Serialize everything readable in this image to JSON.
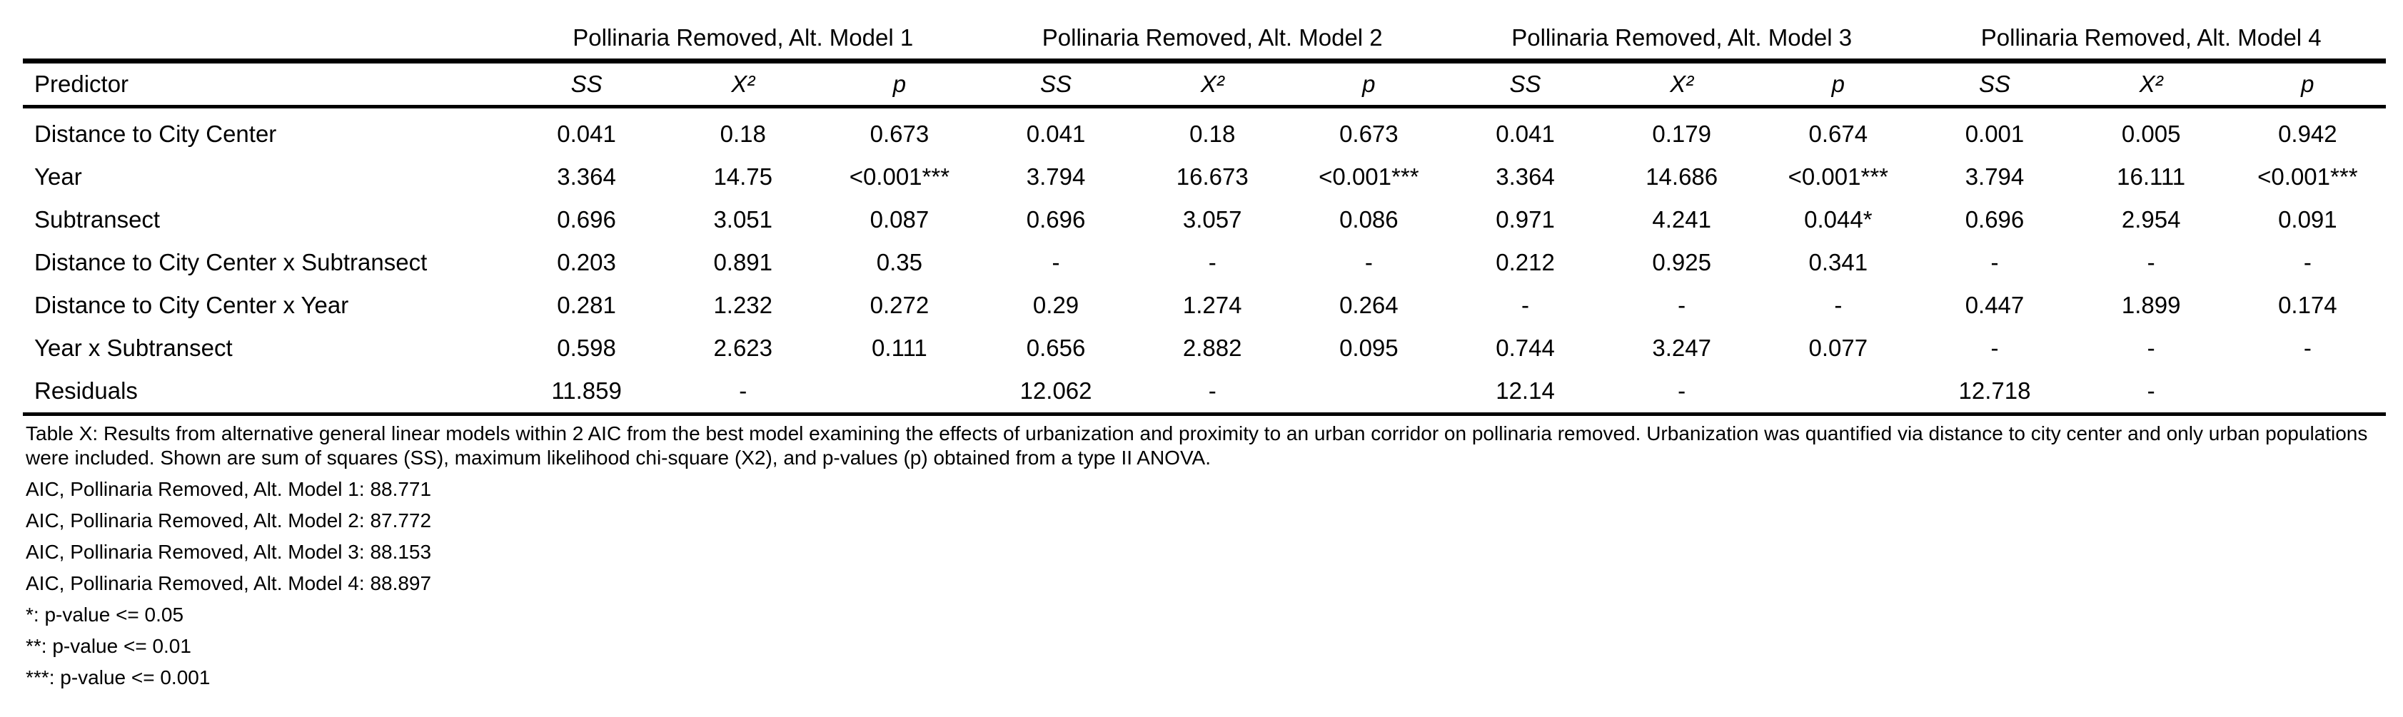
{
  "table": {
    "groups": [
      "Pollinaria Removed, Alt. Model 1",
      "Pollinaria Removed, Alt. Model 2",
      "Pollinaria Removed, Alt. Model 3",
      "Pollinaria Removed, Alt. Model 4"
    ],
    "predictor_header": "Predictor",
    "stat_headers": [
      "SS",
      "X²",
      "p"
    ],
    "rows": [
      {
        "predictor": "Distance to City Center",
        "cells": [
          "0.041",
          "0.18",
          "0.673",
          "0.041",
          "0.18",
          "0.673",
          "0.041",
          "0.179",
          "0.674",
          "0.001",
          "0.005",
          "0.942"
        ]
      },
      {
        "predictor": "Year",
        "cells": [
          "3.364",
          "14.75",
          "<0.001***",
          "3.794",
          "16.673",
          "<0.001***",
          "3.364",
          "14.686",
          "<0.001***",
          "3.794",
          "16.111",
          "<0.001***"
        ]
      },
      {
        "predictor": "Subtransect",
        "cells": [
          "0.696",
          "3.051",
          "0.087",
          "0.696",
          "3.057",
          "0.086",
          "0.971",
          "4.241",
          "0.044*",
          "0.696",
          "2.954",
          "0.091"
        ]
      },
      {
        "predictor": "Distance to City Center x Subtransect",
        "cells": [
          "0.203",
          "0.891",
          "0.35",
          "-",
          "-",
          "-",
          "0.212",
          "0.925",
          "0.341",
          "-",
          "-",
          "-"
        ]
      },
      {
        "predictor": "Distance to City Center x Year",
        "cells": [
          "0.281",
          "1.232",
          "0.272",
          "0.29",
          "1.274",
          "0.264",
          "-",
          "-",
          "-",
          "0.447",
          "1.899",
          "0.174"
        ]
      },
      {
        "predictor": "Year x Subtransect",
        "cells": [
          "0.598",
          "2.623",
          "0.111",
          "0.656",
          "2.882",
          "0.095",
          "0.744",
          "3.247",
          "0.077",
          "-",
          "-",
          "-"
        ]
      },
      {
        "predictor": "Residuals",
        "cells": [
          "11.859",
          "-",
          "",
          "12.062",
          "-",
          "",
          "12.14",
          "-",
          "",
          "12.718",
          "-",
          ""
        ]
      }
    ]
  },
  "notes": {
    "caption": "Table X: Results from alternative general linear models within 2 AIC from the best model examining the effects of urbanization and proximity to an urban corridor on pollinaria removed. Urbanization was quantified via distance to city center and only urban populations were included. Shown are sum of squares (SS), maximum likelihood chi-square (X2), and p-values (p) obtained from a type II ANOVA.",
    "aic": [
      "AIC, Pollinaria Removed, Alt. Model 1: 88.771",
      "AIC, Pollinaria Removed, Alt. Model 2: 87.772",
      "AIC, Pollinaria Removed, Alt. Model 3: 88.153",
      "AIC, Pollinaria Removed, Alt. Model 4: 88.897"
    ],
    "significance": [
      "*: p-value <= 0.05",
      "**: p-value <= 0.01",
      "***: p-value <= 0.001"
    ]
  }
}
